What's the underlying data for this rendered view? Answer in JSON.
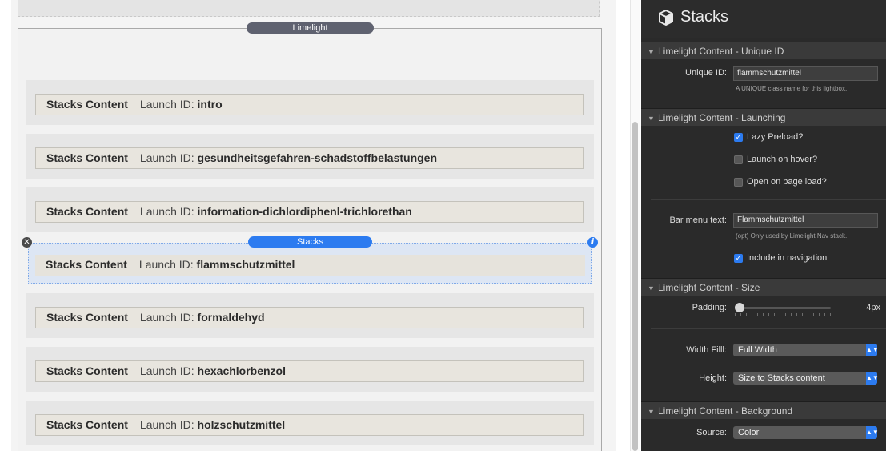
{
  "editor": {
    "limelight_label": "Limelight",
    "stacks_label": "Stacks",
    "rows": [
      {
        "title": "Stacks Content",
        "launch_label": "Launch ID:",
        "launch_id": "intro"
      },
      {
        "title": "Stacks Content",
        "launch_label": "Launch ID:",
        "launch_id": "gesundheitsgefahren-schadstoffbelastungen"
      },
      {
        "title": "Stacks Content",
        "launch_label": "Launch ID:",
        "launch_id": "information-dichlordiphenl-trichlorethan"
      },
      {
        "title": "Stacks Content",
        "launch_label": "Launch ID:",
        "launch_id": "flammschutzmittel"
      },
      {
        "title": "Stacks Content",
        "launch_label": "Launch ID:",
        "launch_id": "formaldehyd"
      },
      {
        "title": "Stacks Content",
        "launch_label": "Launch ID:",
        "launch_id": "hexachlorbenzol"
      },
      {
        "title": "Stacks Content",
        "launch_label": "Launch ID:",
        "launch_id": "holzschutzmittel"
      }
    ]
  },
  "inspector": {
    "title": "Stacks",
    "sections": {
      "unique_id": "Limelight Content - Unique ID",
      "launching": "Limelight Content - Launching",
      "size": "Limelight Content - Size",
      "background": "Limelight Content - Background"
    },
    "unique_id": {
      "label": "Unique ID:",
      "value": "flammschutzmittel",
      "hint": "A UNIQUE class name for this lightbox."
    },
    "launching": {
      "lazy_preload": {
        "label": "Lazy Preload?",
        "checked": true
      },
      "launch_on_hover": {
        "label": "Launch on hover?",
        "checked": false
      },
      "open_on_page_load": {
        "label": "Open on page load?",
        "checked": false
      },
      "bar_menu_label": "Bar menu text:",
      "bar_menu_value": "Flammschutzmittel",
      "bar_menu_hint": "(opt) Only used by Limelight Nav stack.",
      "include_in_nav": {
        "label": "Include in navigation",
        "checked": true
      }
    },
    "size": {
      "padding_label": "Padding:",
      "padding_value": "4px",
      "padding_level": 0.0,
      "width_fill_label": "Width Filll:",
      "width_fill_value": "Full Width",
      "height_label": "Height:",
      "height_value": "Size to Stacks content"
    },
    "background": {
      "source_label": "Source:",
      "source_value": "Color"
    }
  },
  "colors": {
    "accent": "#2c7bf0",
    "panel_bg": "#2a2a2a",
    "section_bg": "#3a3a3a",
    "limelight_pill": "#5f6270"
  }
}
